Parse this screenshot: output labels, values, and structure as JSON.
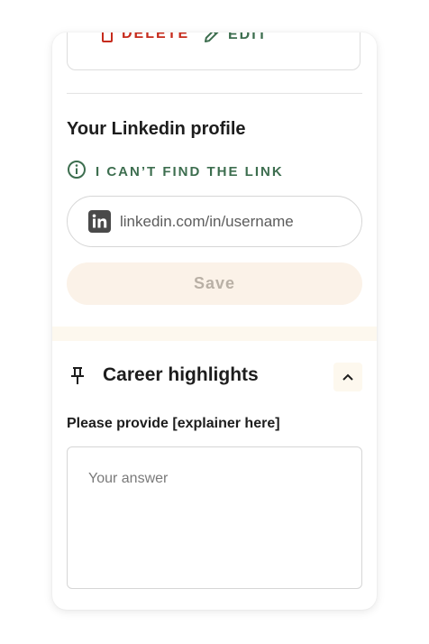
{
  "attachment": {
    "delete_label": "DELETE",
    "edit_label": "EDIT"
  },
  "linkedin": {
    "title": "Your Linkedin profile",
    "help_link": "I CAN’T FIND THE LINK",
    "placeholder": "linkedin.com/in/username",
    "value": "",
    "save_label": "Save"
  },
  "career": {
    "title": "Career highlights",
    "prompt": "Please provide [explainer here]",
    "answer_placeholder": "Your answer",
    "answer_value": ""
  },
  "colors": {
    "accent_green": "#3d6e4f",
    "danger_red": "#c62b1c",
    "cream": "#fbf2e8"
  },
  "icons": {
    "delete": "trash-icon",
    "edit": "pencil-icon",
    "help": "info-icon",
    "linkedin": "linkedin-icon",
    "career": "pin-icon",
    "collapse": "chevron-up-icon"
  }
}
